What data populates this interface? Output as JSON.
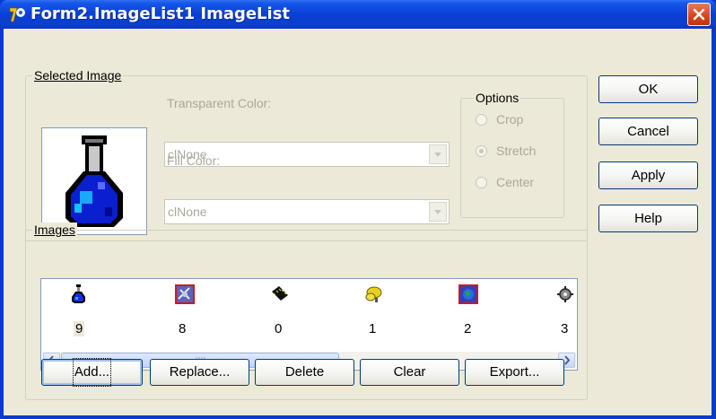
{
  "window": {
    "title": "Form2.ImageList1 ImageList"
  },
  "selected_image": {
    "group_label": "Selected Image",
    "transparent_color_label": "Transparent Color:",
    "transparent_color_value": "clNone",
    "fill_color_label": "Fill Color:",
    "fill_color_value": "clNone",
    "preview_icon": "flask-icon"
  },
  "options": {
    "group_label": "Options",
    "items": [
      {
        "label": "Crop",
        "checked": false
      },
      {
        "label": "Stretch",
        "checked": true
      },
      {
        "label": "Center",
        "checked": false
      }
    ]
  },
  "images": {
    "group_label": "Images",
    "items": [
      {
        "caption": "9",
        "icon": "flask-icon",
        "selected": true
      },
      {
        "caption": "8",
        "icon": "satellite-icon",
        "selected": false
      },
      {
        "caption": "0",
        "icon": "chip-icon",
        "selected": false
      },
      {
        "caption": "1",
        "icon": "yellow-blob-icon",
        "selected": false
      },
      {
        "caption": "2",
        "icon": "globe-icon",
        "selected": false
      },
      {
        "caption": "3",
        "icon": "gear-icon",
        "selected": false
      }
    ],
    "scroll_fraction": 0.58
  },
  "side_buttons": {
    "ok": "OK",
    "cancel": "Cancel",
    "apply": "Apply",
    "help": "Help"
  },
  "bottom_buttons": {
    "add": "Add...",
    "replace": "Replace...",
    "delete": "Delete",
    "clear": "Clear",
    "export": "Export..."
  },
  "colors": {
    "title_bar": "#0a3fd8",
    "dialog_bg": "#ece9d8",
    "disabled_text": "#aca899",
    "close_button": "#d6431d"
  }
}
